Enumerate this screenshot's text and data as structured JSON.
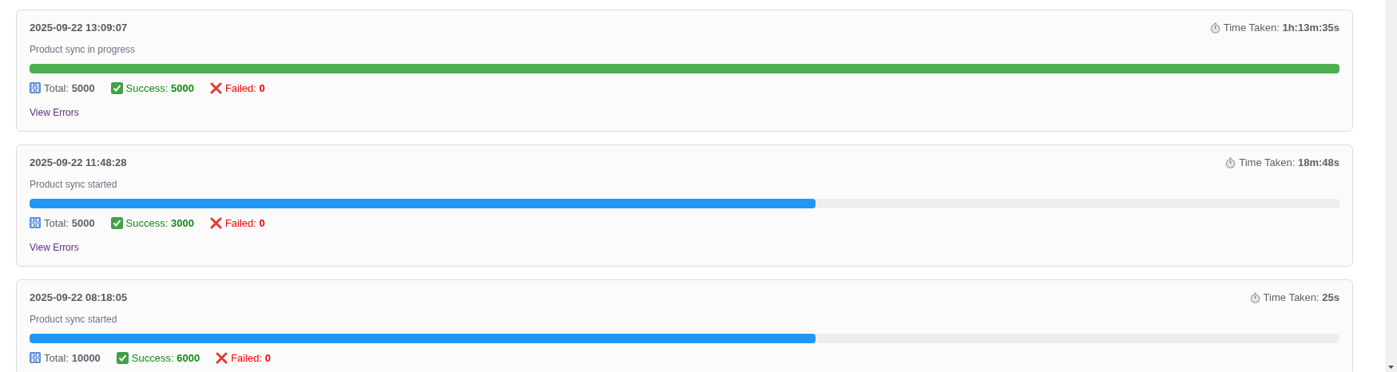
{
  "sync_logs": [
    {
      "timestamp": "2025-09-22 13:09:07",
      "time_taken": "Time Taken: **1h:13m:35s**",
      "description": "Product sync in progress",
      "progress": {
        "level": 1,
        "color": "#4caf50"
      },
      "total": "Total: **5000**",
      "success": "Success: **5000**",
      "failed": "Failed: **0**",
      "link": "View Errors"
    },
    {
      "timestamp": "2025-09-22 11:48:28",
      "time_taken": "Time Taken: **18m:48s**",
      "description": "Product sync started",
      "progress": {
        "level": 0.6,
        "color": "#2196f3"
      },
      "total": "Total: **5000**",
      "success": "Success: **3000**",
      "failed": "Failed: **0**",
      "link": "View Errors"
    },
    {
      "timestamp": "2025-09-22 08:18:05",
      "time_taken": "Time Taken: **25s**",
      "description": "Product sync started",
      "progress": {
        "level": 0.6,
        "color": "#2196f3"
      },
      "total": "Total: **10000**",
      "success": "Success: **6000**",
      "failed": "Failed: **0**"
    }
  ]
}
